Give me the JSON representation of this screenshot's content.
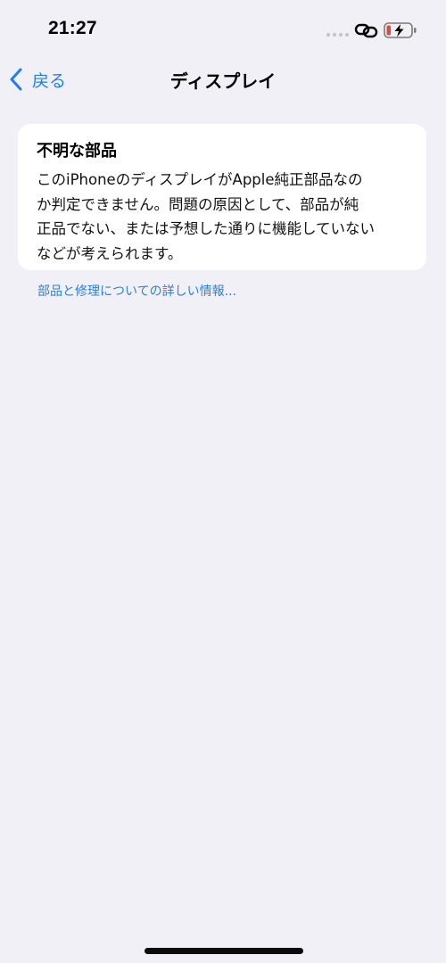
{
  "status_bar": {
    "time": "21:27",
    "icons": [
      "signal-dots-icon",
      "link-icon",
      "battery-charging-low-icon"
    ],
    "battery_color": "#e5473f"
  },
  "nav": {
    "back_label": "戻る",
    "title": "ディスプレイ"
  },
  "card": {
    "title": "不明な部品",
    "body_lines": [
      "このiPhoneのディスプレイがApple純正部品なの",
      "か判定できません。問題の原因として、部品が純",
      "正品でない、または予想した通りに機能していない",
      "などが考えられます。"
    ]
  },
  "learn_more": {
    "label": "部品と修理についての詳しい情報..."
  },
  "colors": {
    "background": "#f1f0f6",
    "accent": "#1f7ff2",
    "card": "#ffffff"
  }
}
